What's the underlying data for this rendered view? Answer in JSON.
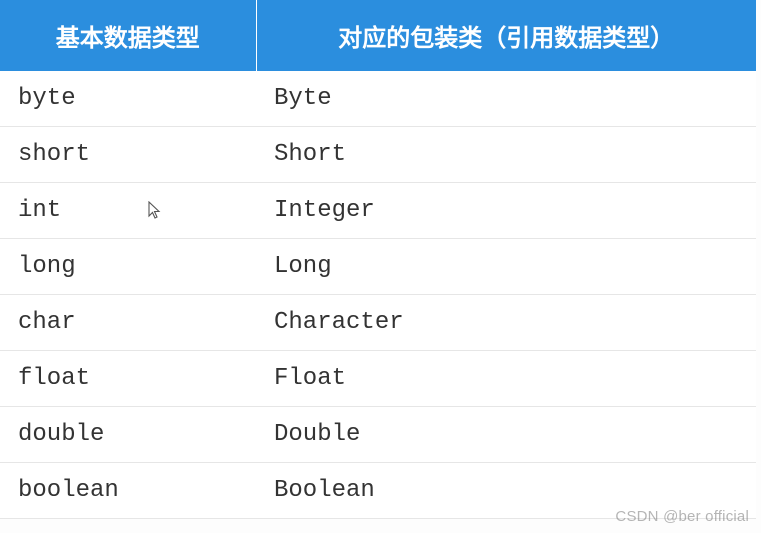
{
  "headers": {
    "col1": "基本数据类型",
    "col2": "对应的包装类（引用数据类型）"
  },
  "rows": [
    {
      "primitive": "byte",
      "wrapper": "Byte",
      "highlight": false
    },
    {
      "primitive": "short",
      "wrapper": "Short",
      "highlight": false
    },
    {
      "primitive": "int",
      "wrapper": "Integer",
      "highlight": true,
      "cursor": true
    },
    {
      "primitive": "long",
      "wrapper": "Long",
      "highlight": false
    },
    {
      "primitive": "char",
      "wrapper": "Character",
      "highlight": true
    },
    {
      "primitive": "float",
      "wrapper": "Float",
      "highlight": false
    },
    {
      "primitive": "double",
      "wrapper": "Double",
      "highlight": false
    },
    {
      "primitive": "boolean",
      "wrapper": "Boolean",
      "highlight": false
    }
  ],
  "watermark": "CSDN @ber official",
  "chart_data": {
    "type": "table",
    "title": "",
    "columns": [
      "基本数据类型",
      "对应的包装类（引用数据类型）"
    ],
    "rows": [
      [
        "byte",
        "Byte"
      ],
      [
        "short",
        "Short"
      ],
      [
        "int",
        "Integer"
      ],
      [
        "long",
        "Long"
      ],
      [
        "char",
        "Character"
      ],
      [
        "float",
        "Float"
      ],
      [
        "double",
        "Double"
      ],
      [
        "boolean",
        "Boolean"
      ]
    ]
  }
}
